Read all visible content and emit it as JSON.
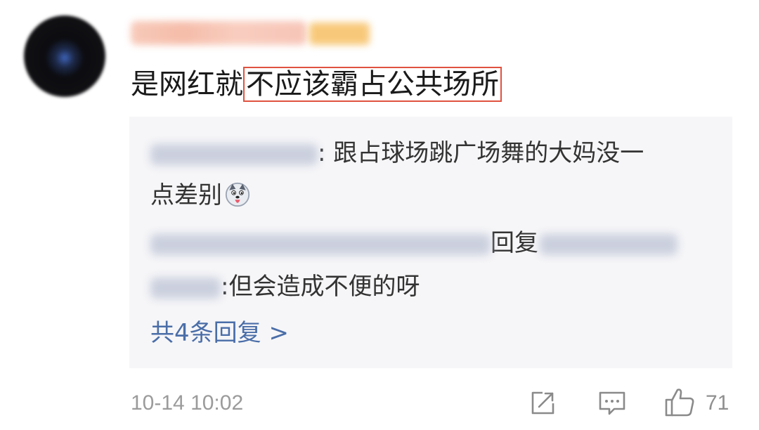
{
  "comment": {
    "text_prefix": "是网红就",
    "text_highlight": "不应该霸占公共场所"
  },
  "replies": {
    "reply1_line1": ": 跟占球场跳广场舞的大妈没一",
    "reply1_line2": "点差别",
    "reply2_mid": "回复",
    "reply2_text": ":但会造成不便的呀",
    "more_label": "共4条回复 >"
  },
  "footer": {
    "timestamp": "10-14 10:02",
    "like_count": "71"
  },
  "icons": {
    "share": "share-icon",
    "comment": "comment-icon",
    "like": "thumbs-up-icon",
    "emoji": "dog-tongue-emoji-icon"
  },
  "colors": {
    "highlight_border": "#e0523f",
    "link": "#4a6ea8",
    "panel_bg": "#f6f6f8",
    "meta_text": "#9b9b9b"
  }
}
